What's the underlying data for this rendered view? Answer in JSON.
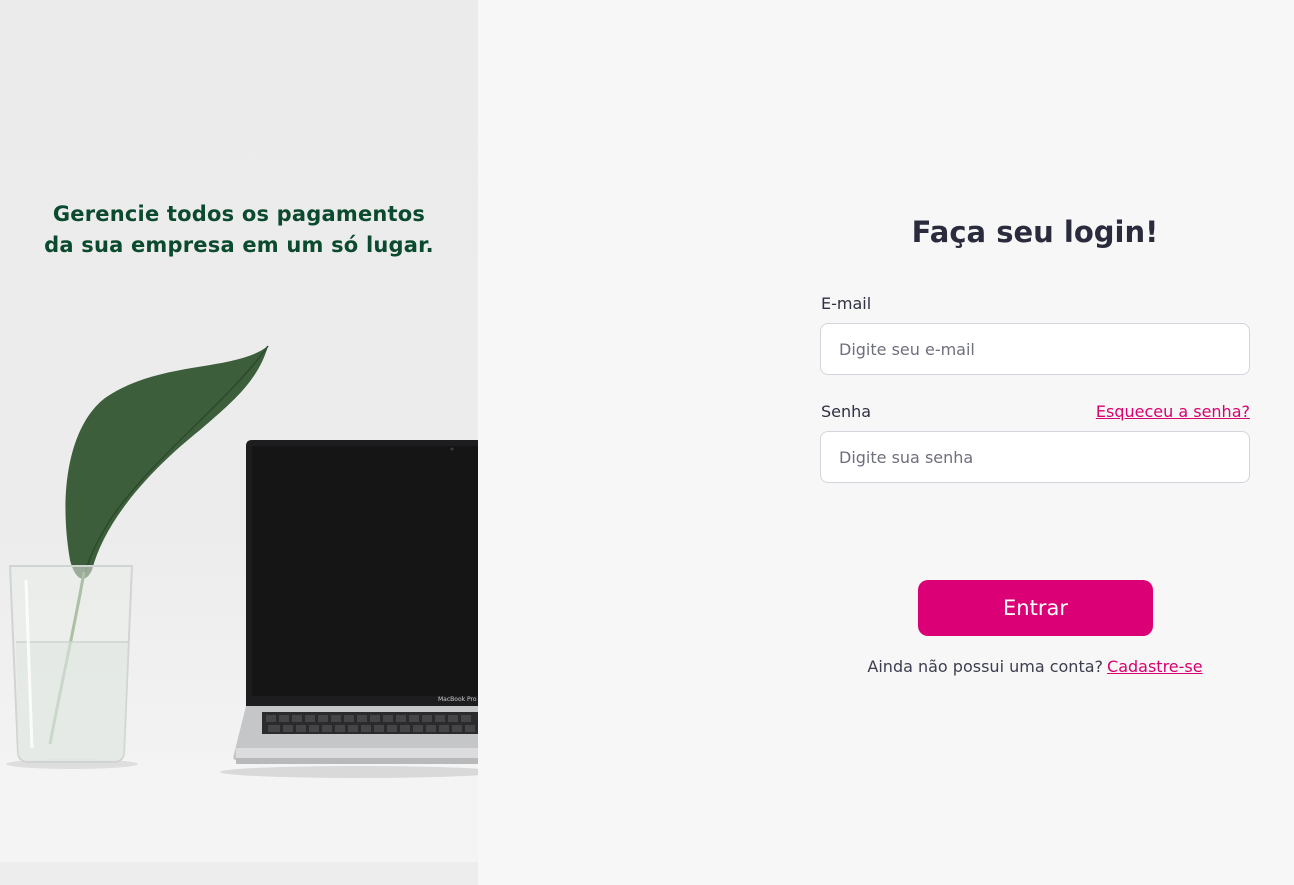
{
  "hero": {
    "tagline": "Gerencie todos os pagamentos da sua empresa em um só lugar.",
    "laptop_brand": "MacBook Pro"
  },
  "login": {
    "title": "Faça seu login!",
    "email": {
      "label": "E-mail",
      "placeholder": "Digite seu e-mail",
      "value": ""
    },
    "password": {
      "label": "Senha",
      "placeholder": "Digite sua senha",
      "value": "",
      "forgot_link": "Esqueceu a senha?"
    },
    "submit_label": "Entrar",
    "signup_prompt": "Ainda não possui uma conta?",
    "signup_link": "Cadastre-se"
  },
  "colors": {
    "accent": "#dc0076",
    "link": "#d7006f",
    "tagline": "#0b4a2e",
    "title": "#2a2b3d",
    "background": "#f7f7f7"
  }
}
